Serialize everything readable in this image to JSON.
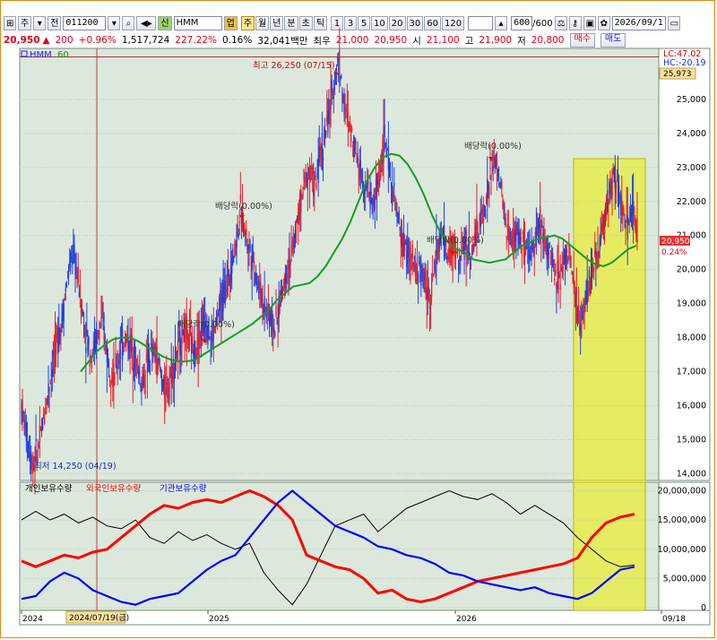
{
  "toolbar": {
    "type_label": "주",
    "market_label": "전",
    "code": "011200",
    "badge_label": "신",
    "name": "HMM",
    "badge2_label": "업",
    "periods": [
      "주",
      "월",
      "년",
      "분",
      "초",
      "틱"
    ],
    "intervals": [
      "1",
      "3",
      "5",
      "10",
      "20",
      "30",
      "60",
      "120"
    ],
    "count": "600",
    "count_total": "/600",
    "date": "2026/09/1"
  },
  "quote": {
    "price": "20,950",
    "arrow": "▲",
    "change": "200",
    "change_pct": "+0.96%",
    "volume": "1,517,724",
    "vol_ratio": "227.22%",
    "turnover": "0.16%",
    "amount": "32,041백만",
    "high_label": "최우",
    "best": "21,000",
    "best2": "20,950",
    "open_label": "시",
    "open": "21,100",
    "hi_label": "고",
    "hi": "21,900",
    "lo_label": "저",
    "lo": "20,800",
    "buy_label": "매수",
    "sell_label": "매도"
  },
  "chart_data": [
    {
      "type": "candlestick",
      "title": "HMM",
      "legend": [
        {
          "name": "HMM",
          "color": "#1a1aff"
        },
        {
          "name": "60",
          "color": "#1a8a1a"
        }
      ],
      "ylim": [
        13800,
        26500
      ],
      "yticks": [
        14000,
        15000,
        16000,
        17000,
        18000,
        19000,
        20000,
        21000,
        22000,
        23000,
        24000,
        25000
      ],
      "ytick_labels": [
        "14,000",
        "15,000",
        "16,000",
        "17,000",
        "18,000",
        "19,000",
        "20,000",
        "21,000",
        "22,000",
        "23,000",
        "24,000",
        "25,000"
      ],
      "xticks": [
        "2024",
        "2025",
        "2026",
        "09/18"
      ],
      "cursor_label": "2024/07/19(금)",
      "high_line_value": "25,973",
      "lc_label": "LC:47.02",
      "hc_label": "HC:-20.19",
      "last_price": "20,950",
      "last_pct": "0.24%",
      "annotations": [
        {
          "text": "최고 26,250 (07/15)",
          "x": "2025-07-15",
          "y": 26250
        },
        {
          "text": "최저 14,250 (04/19)",
          "x": "2024-04-19",
          "y": 14250
        },
        {
          "text": "배당락(0.00%)",
          "x": "2024-12",
          "y": 22100
        },
        {
          "text": "배당락(0.00%)",
          "x": "2024-12",
          "y": 18100
        },
        {
          "text": "배당락(0.00%)",
          "x": "2025-12",
          "y": 23300
        },
        {
          "text": "배당락(0.00%)",
          "x": "2025-10",
          "y": 20900
        }
      ],
      "close_series": [
        16000,
        15000,
        14250,
        14800,
        15800,
        16800,
        17800,
        18500,
        19800,
        20500,
        19500,
        18200,
        17500,
        17900,
        18500,
        17400,
        16800,
        17500,
        18000,
        17800,
        17200,
        16600,
        17300,
        17600,
        17100,
        16300,
        17000,
        17500,
        18200,
        18000,
        17600,
        18100,
        18500,
        17900,
        18600,
        19200,
        19900,
        20600,
        21700,
        21000,
        20400,
        19600,
        19000,
        18700,
        18200,
        19200,
        20000,
        20500,
        21500,
        22500,
        23000,
        22400,
        23500,
        24200,
        25200,
        26250,
        24800,
        24200,
        23600,
        22800,
        22400,
        21900,
        22600,
        23900,
        22800,
        21700,
        20900,
        20500,
        20100,
        20000,
        19600,
        19200,
        20500,
        21000,
        20400,
        20700,
        20200,
        20800,
        20400,
        21100,
        21600,
        22300,
        23300,
        22600,
        21300,
        20800,
        21100,
        20700,
        20300,
        20900,
        21400,
        20800,
        20300,
        19800,
        20200,
        20600,
        19200,
        18300,
        19400,
        19800,
        20500,
        21400,
        22300,
        22800,
        21900,
        21300,
        21700,
        20950
      ],
      "ma60_series": [
        17000,
        17300,
        17600,
        17800,
        17950,
        18000,
        18000,
        17900,
        17750,
        17600,
        17450,
        17350,
        17300,
        17300,
        17350,
        17500,
        17650,
        17800,
        17950,
        18100,
        18250,
        18400,
        18600,
        18800,
        19100,
        19300,
        19500,
        19550,
        19600,
        19800,
        20100,
        20500,
        20900,
        21400,
        22000,
        22600,
        23000,
        23300,
        23400,
        23350,
        23100,
        22700,
        22200,
        21600,
        21100,
        20800,
        20600,
        20500,
        20300,
        20250,
        20200,
        20250,
        20300,
        20500,
        20700,
        20800,
        20900,
        20950,
        21000,
        20900,
        20700,
        20500,
        20300,
        20150,
        20100,
        20200,
        20400,
        20600,
        20700
      ]
    },
    {
      "type": "line",
      "series": [
        {
          "name": "개인보유수량",
          "color": "#000000"
        },
        {
          "name": "외국인보유수량",
          "color": "#ff0000"
        },
        {
          "name": "기관보유수량",
          "color": "#0000ff"
        }
      ],
      "ylim": [
        0,
        21000000
      ],
      "yticks": [
        0,
        5000000,
        10000000,
        15000000,
        20000000
      ],
      "ytick_labels": [
        "0",
        "5,000,000",
        "10,000,000",
        "15,000,000",
        "20,000,000"
      ],
      "individual": [
        15000000,
        16500000,
        15000000,
        16000000,
        14500000,
        15500000,
        14000000,
        13500000,
        15000000,
        12000000,
        11000000,
        13000000,
        11500000,
        12500000,
        11000000,
        10000000,
        11000000,
        6000000,
        3000000,
        500000,
        4000000,
        9000000,
        14000000,
        15000000,
        16000000,
        13000000,
        15000000,
        17000000,
        18000000,
        19000000,
        20000000,
        19000000,
        18500000,
        19500000,
        18000000,
        16000000,
        17500000,
        16000000,
        14500000,
        12000000,
        10000000,
        8000000,
        7000000,
        7300000
      ],
      "foreign": [
        8000000,
        7000000,
        8000000,
        9000000,
        8500000,
        9500000,
        10000000,
        12000000,
        14000000,
        16000000,
        17500000,
        17000000,
        18000000,
        18500000,
        18000000,
        19000000,
        20000000,
        19000000,
        17500000,
        15000000,
        9000000,
        8000000,
        7000000,
        6500000,
        5000000,
        2500000,
        3000000,
        1500000,
        1000000,
        1500000,
        2500000,
        3500000,
        4500000,
        5000000,
        5500000,
        6000000,
        6500000,
        7000000,
        7500000,
        8500000,
        12000000,
        14500000,
        15500000,
        16000000
      ],
      "institution": [
        1500000,
        2000000,
        4500000,
        6000000,
        5000000,
        3000000,
        2000000,
        1000000,
        500000,
        1500000,
        2000000,
        2500000,
        4500000,
        6500000,
        8000000,
        9000000,
        12000000,
        15000000,
        18000000,
        20000000,
        18000000,
        16000000,
        14000000,
        13000000,
        12000000,
        10500000,
        10000000,
        9000000,
        8500000,
        7500000,
        6000000,
        5500000,
        4500000,
        4000000,
        3500000,
        3000000,
        3500000,
        2500000,
        2000000,
        1500000,
        2500000,
        4500000,
        6500000,
        7000000
      ]
    }
  ]
}
